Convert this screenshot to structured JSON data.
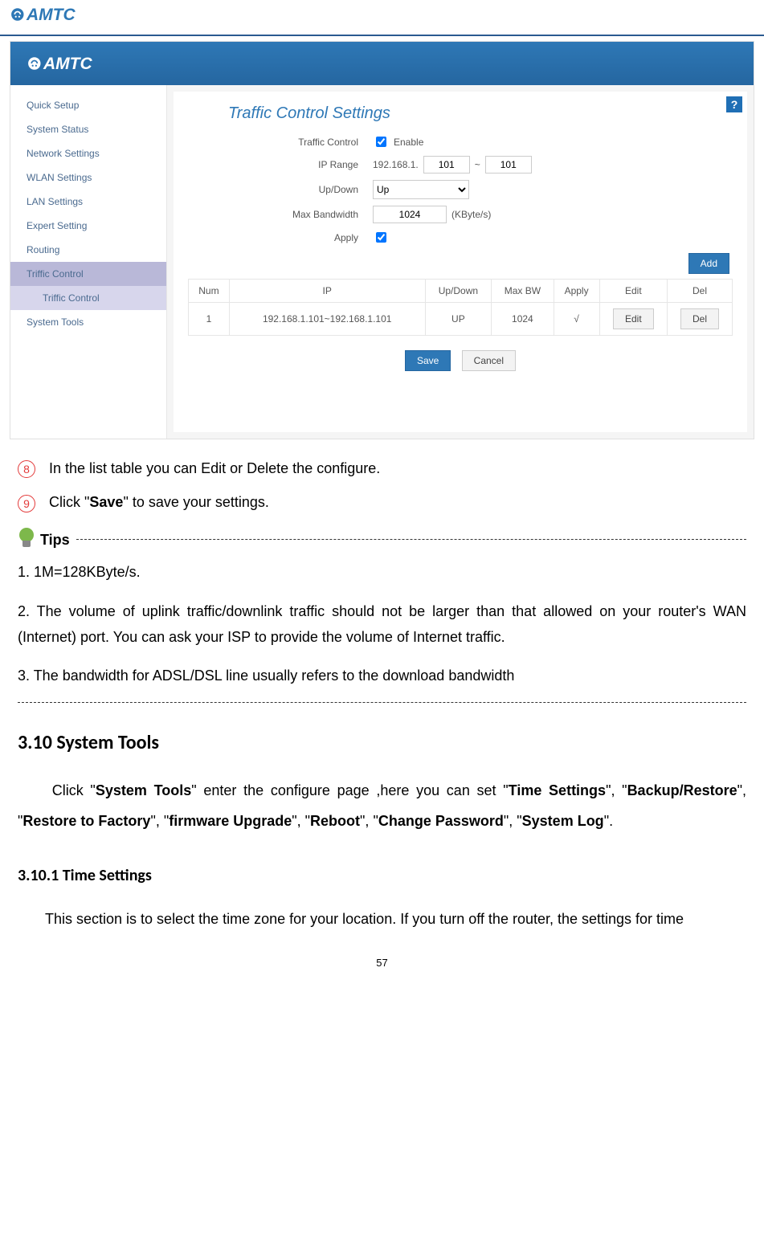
{
  "brand": "AMTC",
  "ui": {
    "sidebar": {
      "items": [
        "Quick Setup",
        "System Status",
        "Network Settings",
        "WLAN Settings",
        "LAN Settings",
        "Expert Setting",
        "Routing",
        "Triffic Control",
        "System Tools"
      ],
      "expanded_label": "Triffic Control",
      "subitem": "Triffic Control"
    },
    "panel": {
      "title": "Traffic Control Settings",
      "rows": {
        "traffic_control_label": "Traffic Control",
        "enable_label": "Enable",
        "enable_checked": true,
        "ip_range_label": "IP Range",
        "ip_prefix": "192.168.1.",
        "ip_from": "101",
        "ip_sep": "~",
        "ip_to": "101",
        "updown_label": "Up/Down",
        "updown_value": "Up",
        "maxbw_label": "Max Bandwidth",
        "maxbw_value": "1024",
        "maxbw_unit": "(KByte/s)",
        "apply_label": "Apply",
        "apply_checked": true
      },
      "add_label": "Add",
      "table": {
        "headers": [
          "Num",
          "IP",
          "Up/Down",
          "Max BW",
          "Apply",
          "Edit",
          "Del"
        ],
        "rows": [
          {
            "num": "1",
            "ip": "192.168.1.101~192.168.1.101",
            "updown": "UP",
            "maxbw": "1024",
            "apply": "√",
            "edit": "Edit",
            "del": "Del"
          }
        ]
      },
      "save_label": "Save",
      "cancel_label": "Cancel"
    },
    "help_glyph": "?"
  },
  "doc": {
    "step8_num": "8",
    "step8_text": "In the list table you can Edit or Delete the configure.",
    "step9_num": "9",
    "step9_prefix": "Click \"",
    "step9_bold": "Save",
    "step9_suffix": "\" to save your settings.",
    "tips_label": "Tips",
    "tips": [
      "1. 1M=128KByte/s.",
      "2. The volume of uplink traffic/downlink traffic should not be larger than that allowed on your router's WAN (Internet) port. You can ask your ISP to provide the volume of Internet traffic.",
      "3. The bandwidth for ADSL/DSL line usually refers to the download bandwidth"
    ],
    "h310": "3.10 System Tools",
    "systools_para": {
      "p1_a": "Click \"",
      "p1_b": "System Tools",
      "p1_c": "\" enter the configure page ,here you can set \"",
      "p1_d": "Time Settings",
      "p1_e": "\", \"",
      "p1_f": "Backup/Restore",
      "p1_g": "\", \"",
      "p1_h": "Restore to Factory",
      "p1_i": "\", \"",
      "p1_j": "firmware Upgrade",
      "p1_k": "\", \"",
      "p1_l": "Reboot",
      "p1_m": "\", \"",
      "p1_n": "Change Password",
      "p1_o": "\", \"",
      "p1_p": "System Log",
      "p1_q": "\"."
    },
    "h3101": "3.10.1 Time Settings",
    "timesettings_para": "This section is to select the time zone for your location. If you turn off the router, the settings for time",
    "page_number": "57"
  }
}
